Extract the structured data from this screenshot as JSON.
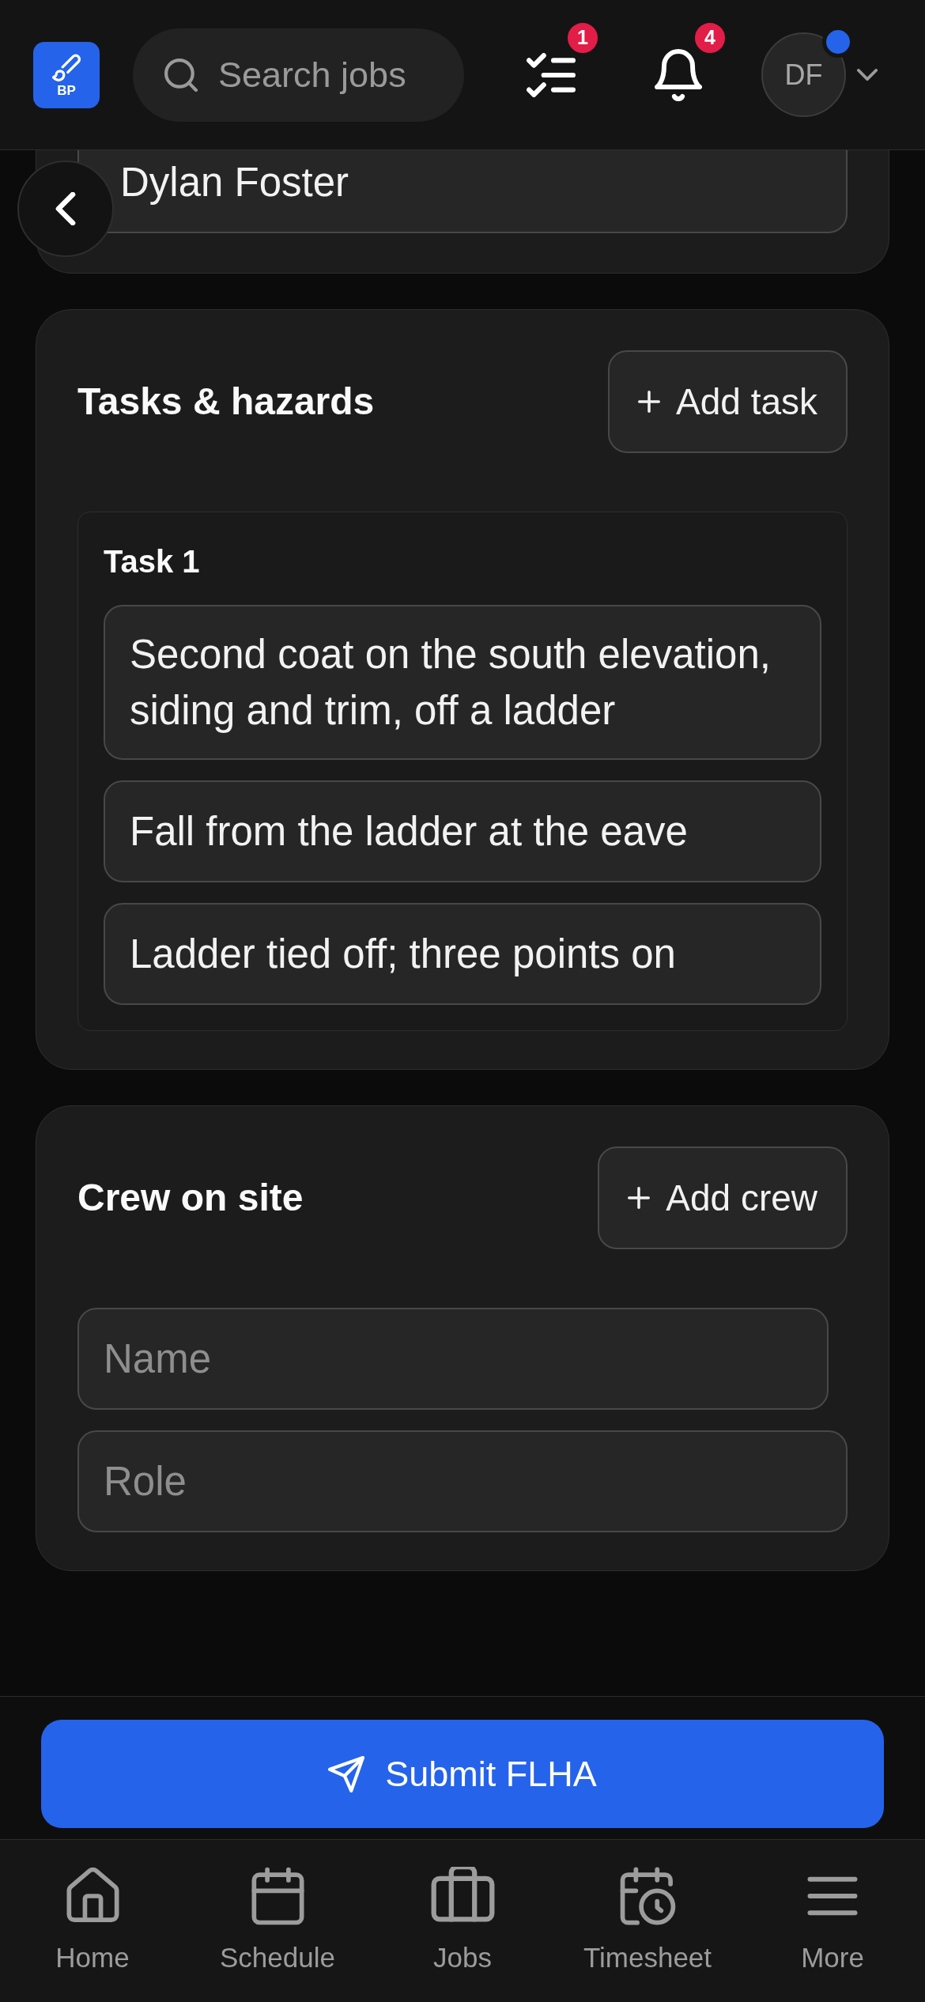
{
  "header": {
    "logo": "BP",
    "search": {
      "placeholder": "Search jobs"
    },
    "checklist_badge": "1",
    "notifications_badge": "4",
    "avatar": {
      "initials": "DF",
      "status_dot": true
    }
  },
  "partial_card": {
    "field": {
      "value": "Dylan Foster"
    }
  },
  "tasks_section": {
    "title": "Tasks & hazards",
    "add_button": "Add task",
    "tasks": [
      {
        "label": "Task 1",
        "fields": [
          {
            "kind": "textarea",
            "value": "Second coat on the south elevation, siding and trim, off a ladder"
          },
          {
            "kind": "input",
            "value": "Fall from the ladder at the eave"
          },
          {
            "kind": "input",
            "value": "Ladder tied off; three points on"
          }
        ]
      }
    ]
  },
  "crew_section": {
    "title": "Crew on site",
    "add_button": "Add crew",
    "fields": [
      {
        "placeholder": "Name"
      },
      {
        "placeholder": "Role"
      }
    ]
  },
  "submit_button": "Submit FLHA",
  "bottom_nav": [
    {
      "label": "Home",
      "selected": false
    },
    {
      "label": "Schedule",
      "selected": false
    },
    {
      "label": "Jobs",
      "selected": false
    },
    {
      "label": "Timesheet",
      "selected": false
    },
    {
      "label": "More",
      "selected": false
    }
  ]
}
